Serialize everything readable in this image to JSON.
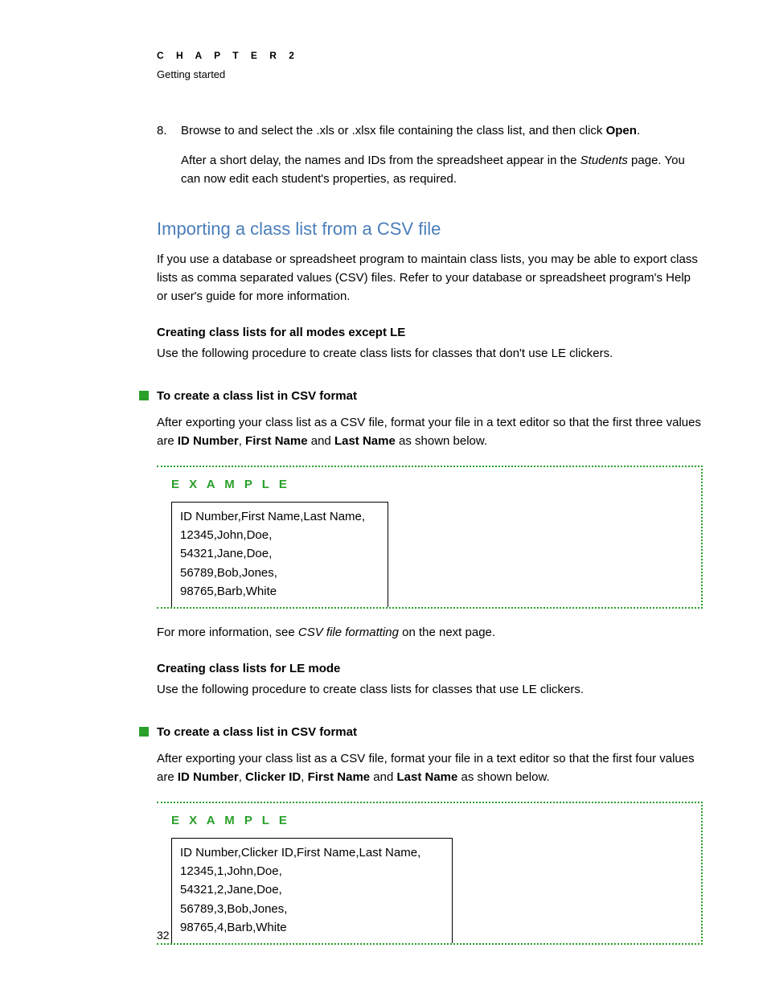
{
  "header": {
    "chapter": "C H A P T E R   2",
    "subtitle": "Getting started"
  },
  "step8": {
    "num": "8.",
    "line1_a": "Browse to and select the .xls or .xlsx file containing the class list, and then click ",
    "line1_b": "Open",
    "line1_c": ".",
    "line2_a": "After a short delay, the names and IDs from the spreadsheet appear in the ",
    "line2_b": "Students",
    "line2_c": " page. You can now edit each student's properties, as required."
  },
  "h2": "Importing a class list from a CSV file",
  "intro": "If you use a database or spreadsheet program to maintain class lists, you may be able to export class lists as comma separated values (CSV) files. Refer to your database or spreadsheet program's Help or user's guide for more information.",
  "sub1_head": "Creating class lists for all modes except LE",
  "sub1_text": "Use the following procedure to create class lists for classes that don't use LE clickers.",
  "proc1_head": "To create a class list in CSV format",
  "proc1_text_a": "After exporting your class list as a CSV file, format your file in a text editor so that the first three values are ",
  "proc1_b1": "ID Number",
  "proc1_sep1": ", ",
  "proc1_b2": "First Name",
  "proc1_sep2": " and ",
  "proc1_b3": "Last Name",
  "proc1_text_b": " as shown below.",
  "example_label": "E X A M P L E",
  "example1_lines": [
    "ID Number,First Name,Last Name,",
    "12345,John,Doe,",
    "54321,Jane,Doe,",
    "56789,Bob,Jones,",
    "98765,Barb,White"
  ],
  "moreinfo_a": "For more information, see ",
  "moreinfo_b": "CSV file formatting",
  "moreinfo_c": " on the next page.",
  "sub2_head": "Creating class lists for LE mode",
  "sub2_text": "Use the following procedure to create class lists for classes that use LE clickers.",
  "proc2_head": "To create a class list in CSV format",
  "proc2_text_a": "After exporting your class list as a CSV file, format your file in a text editor so that the first four values are ",
  "proc2_b1": "ID Number",
  "proc2_sep1": ", ",
  "proc2_b2": "Clicker ID",
  "proc2_sep2": ", ",
  "proc2_b3": "First Name",
  "proc2_sep3": " and ",
  "proc2_b4": "Last Name",
  "proc2_text_b": " as shown below.",
  "example2_lines": [
    "ID Number,Clicker ID,First Name,Last Name,",
    "12345,1,John,Doe,",
    "54321,2,Jane,Doe,",
    "56789,3,Bob,Jones,",
    "98765,4,Barb,White"
  ],
  "page_number": "32"
}
